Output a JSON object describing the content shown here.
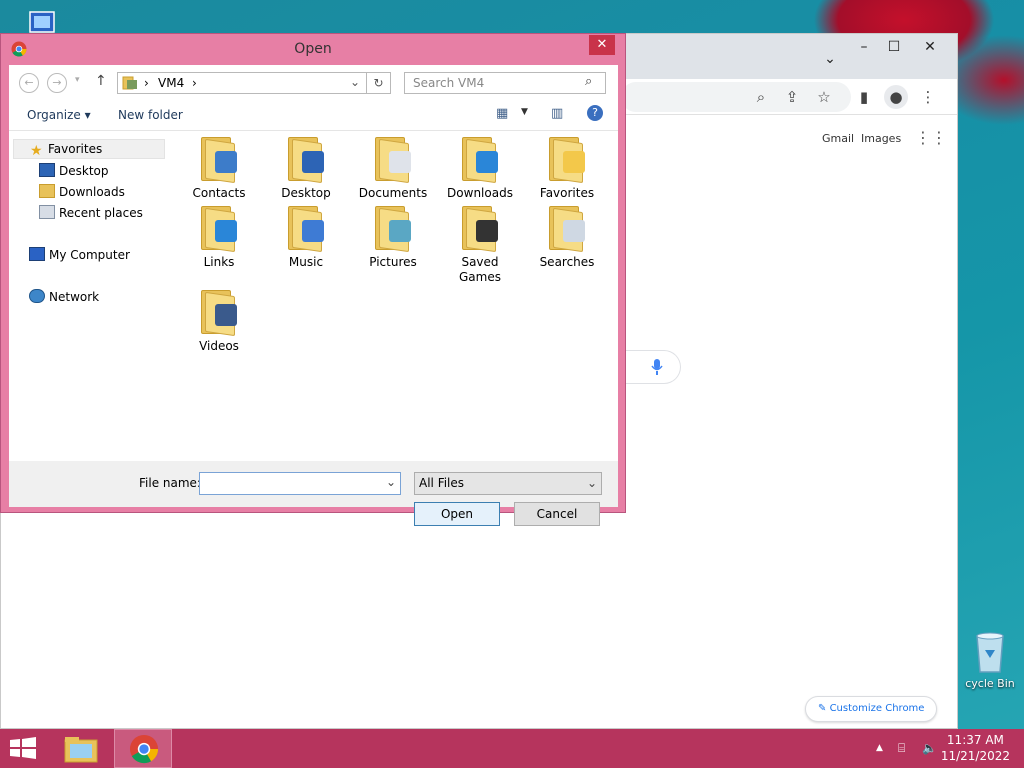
{
  "dialog": {
    "title": "Open",
    "address": {
      "root_sep": "›",
      "folder": "VM4",
      "trail_sep": "›"
    },
    "search_placeholder": "Search VM4",
    "toolbar": {
      "organize": "Organize ▾",
      "new_folder": "New folder"
    },
    "nav": {
      "favorites": "Favorites",
      "desktop": "Desktop",
      "downloads": "Downloads",
      "recent": "Recent places",
      "computer": "My Computer",
      "network": "Network"
    },
    "items": [
      {
        "label": "Contacts",
        "badge": "#3d7cc9"
      },
      {
        "label": "Desktop",
        "badge": "#2d64b5"
      },
      {
        "label": "Documents",
        "badge": "#dfe3ea"
      },
      {
        "label": "Downloads",
        "badge": "#2a86d8"
      },
      {
        "label": "Favorites",
        "badge": "#f3c84a"
      },
      {
        "label": "Links",
        "badge": "#2a86d8"
      },
      {
        "label": "Music",
        "badge": "#3e7bd4"
      },
      {
        "label": "Pictures",
        "badge": "#5aa7c4"
      },
      {
        "label": "Saved Games",
        "badge": "#333333"
      },
      {
        "label": "Searches",
        "badge": "#cfd8e3"
      },
      {
        "label": "Videos",
        "badge": "#3a5a8c"
      }
    ],
    "file_name_label": "File name:",
    "file_name_value": "",
    "file_type": "All Files",
    "open_label": "Open",
    "cancel_label": "Cancel"
  },
  "chrome": {
    "gmail": "Gmail",
    "images": "Images",
    "customize": "Customize Chrome"
  },
  "desktop": {
    "recycle_label": "cycle Bin"
  },
  "taskbar": {
    "time": "11:37 AM",
    "date": "11/21/2022"
  },
  "colors": {
    "accent": "#e77fa5",
    "taskbar": "#b6345d"
  }
}
